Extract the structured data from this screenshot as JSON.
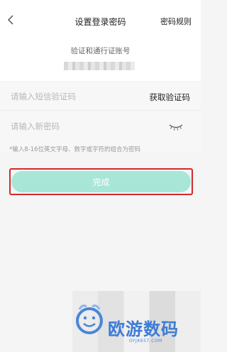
{
  "header": {
    "title": "设置登录密码",
    "right_link": "密码规则"
  },
  "account": {
    "label": "验证和通行证账号",
    "value": ""
  },
  "form": {
    "code_placeholder": "请输入短信验证码",
    "get_code_label": "获取验证码",
    "password_placeholder": "请输入新密码",
    "hint": "*输入8-16位英文字母、数字或字符的组合为密码"
  },
  "done_button_label": "完成",
  "watermark": {
    "text": "欧游数码",
    "subtext": "OYJK657.COM"
  },
  "colors": {
    "button_bg": "#a8e6d8",
    "highlight_frame": "#d02b2b",
    "watermark_blue": "#3d7bd6"
  }
}
